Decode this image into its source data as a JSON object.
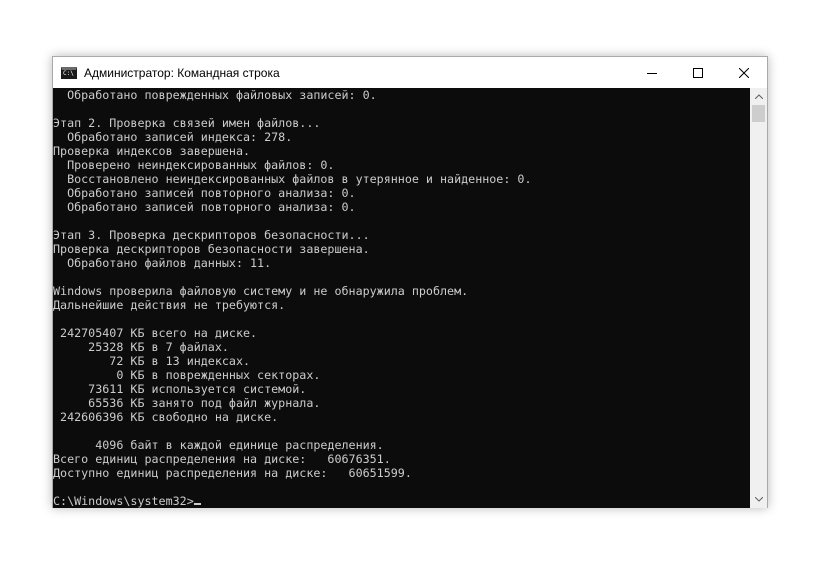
{
  "window": {
    "title": "Администратор: Командная строка",
    "icon_text": "C:\\"
  },
  "controls": {
    "minimize": "minimize-icon",
    "maximize": "maximize-icon",
    "close": "close-icon"
  },
  "console": {
    "lines": [
      "  Обработано поврежденных файловых записей: 0.",
      "",
      "Этап 2. Проверка связей имен файлов...",
      "  Обработано записей индекса: 278.",
      "Проверка индексов завершена.",
      "  Проверено неиндексированных файлов: 0.",
      "  Восстановлено неиндексированных файлов в утерянное и найденное: 0.",
      "  Обработано записей повторного анализа: 0.",
      "  Обработано записей повторного анализа: 0.",
      "",
      "Этап 3. Проверка дескрипторов безопасности...",
      "Проверка дескрипторов безопасности завершена.",
      "  Обработано файлов данных: 11.",
      "",
      "Windows проверила файловую систему и не обнаружила проблем.",
      "Дальнейшие действия не требуются.",
      "",
      " 242705407 КБ всего на диске.",
      "     25328 КБ в 7 файлах.",
      "        72 КБ в 13 индексах.",
      "         0 КБ в поврежденных секторах.",
      "     73611 КБ используется системой.",
      "     65536 КБ занято под файл журнала.",
      " 242606396 КБ свободно на диске.",
      "",
      "      4096 байт в каждой единице распределения.",
      "Всего единиц распределения на диске:   60676351.",
      "Доступно единиц распределения на диске:   60651599.",
      ""
    ],
    "prompt": "C:\\Windows\\system32>"
  },
  "colors": {
    "console_bg": "#0c0c0c",
    "console_text": "#cccccc",
    "titlebar_bg": "#ffffff",
    "scrollbar_bg": "#f0f0f0",
    "scrollbar_thumb": "#cdcdcd"
  }
}
